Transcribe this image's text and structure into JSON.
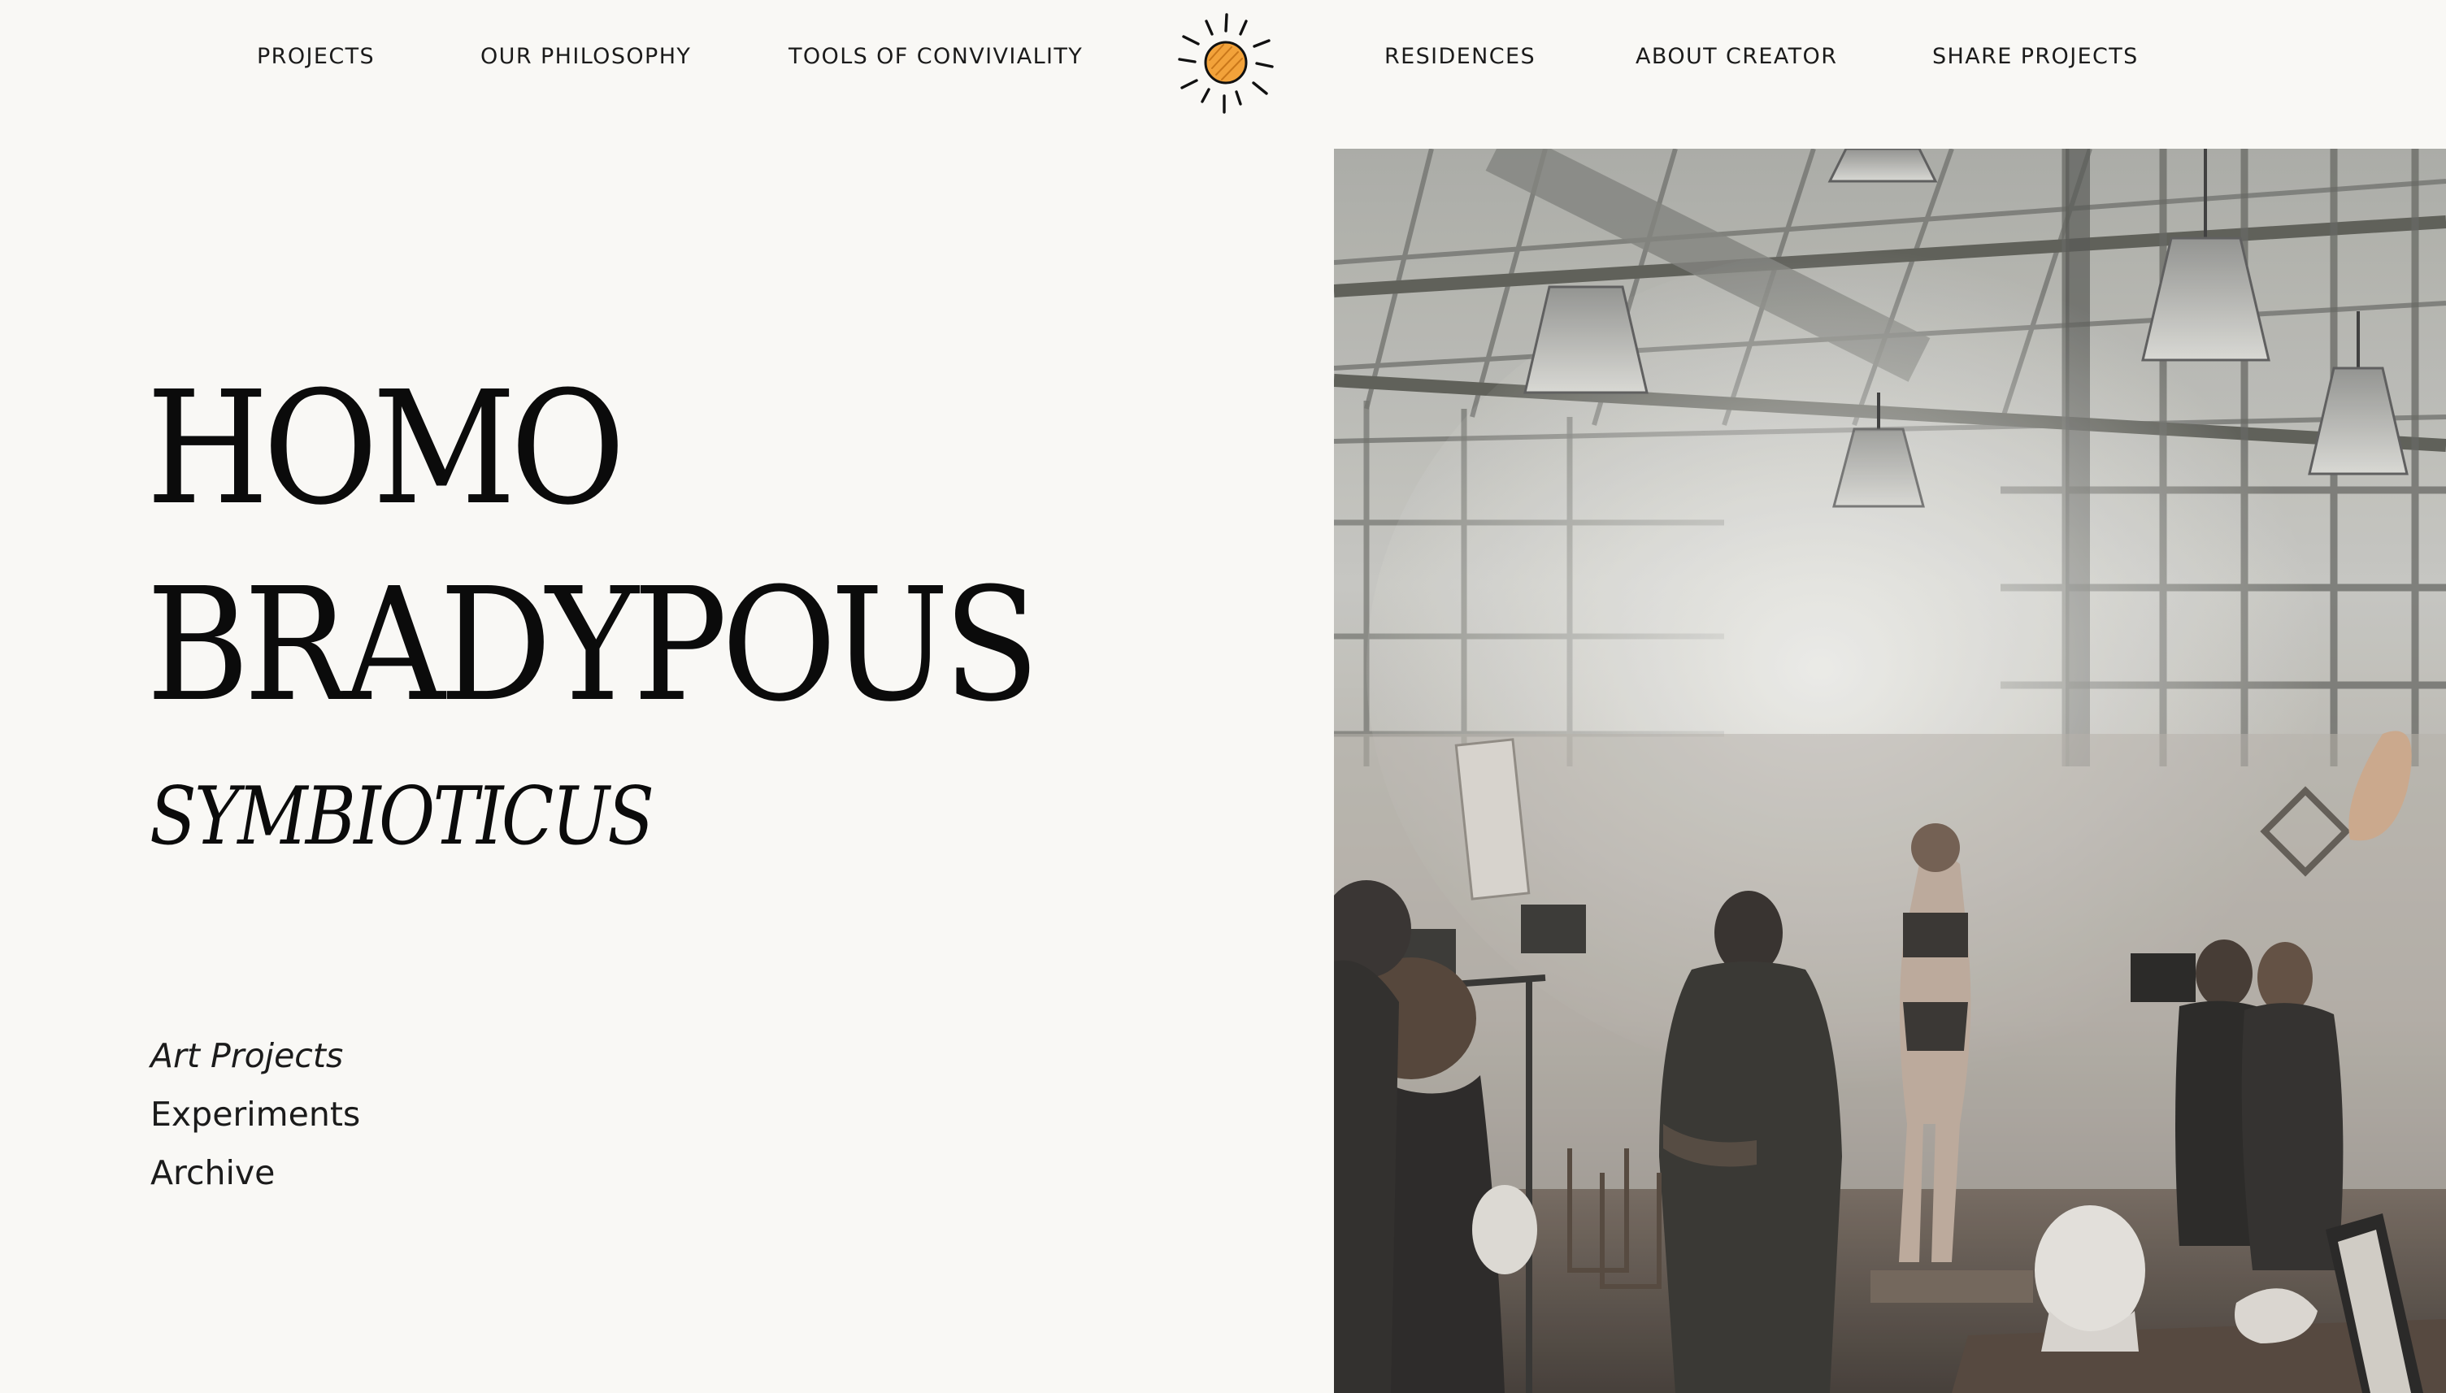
{
  "nav": {
    "left_links": [
      "PROJECTS",
      "OUR PHILOSOPHY",
      "TOOLS OF CONVIVIALITY"
    ],
    "right_links": [
      "RESIDENCES",
      "ABOUT CREATOR",
      "SHARE PROJECTS"
    ],
    "logo_icon": "sun-icon"
  },
  "hero": {
    "title_line1": "HOMO",
    "title_line2": "BRADYPOUS",
    "subtitle": "SYMBIOTICUS"
  },
  "menu": {
    "items": [
      "Art Projects",
      "Experiments",
      "Archive"
    ],
    "active": "Art Projects"
  },
  "colors": {
    "background": "#f9f8f5",
    "text": "#111111",
    "accent": "#f2a23a"
  }
}
